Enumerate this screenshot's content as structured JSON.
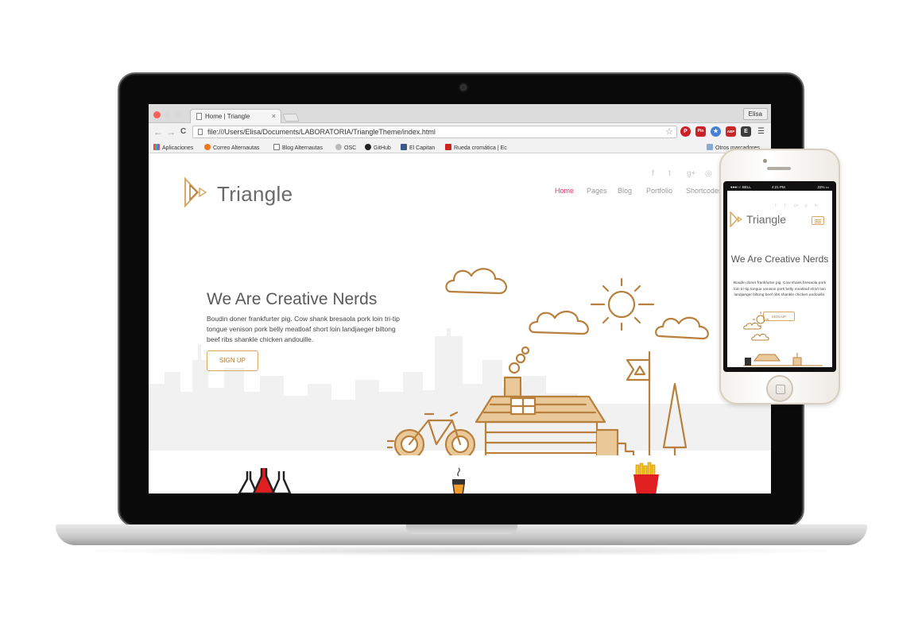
{
  "browser": {
    "tab_title": "Home | Triangle",
    "tab_close": "×",
    "user_name": "Elisa",
    "url": "file:///Users/Elisa/Documents/LABORATORIA/TriangleTheme/index.html",
    "back": "←",
    "forward": "→",
    "reload": "C",
    "menu": "☰",
    "bookmarks": [
      {
        "label": "Aplicaciones",
        "icon_color": "#e44"
      },
      {
        "label": "Correo Alternautas",
        "icon_color": "#f2771c"
      },
      {
        "label": "Blog Alternautas",
        "icon_color": "#ffffff"
      },
      {
        "label": "OSC",
        "icon_color": "#bbbbbb"
      },
      {
        "label": "GitHub",
        "icon_color": "#222222"
      },
      {
        "label": "El Capitan",
        "icon_color": "#3a5a88"
      },
      {
        "label": "Rueda cromática | Ec",
        "icon_color": "#cc2222"
      }
    ],
    "other_bookmarks": "Otros marcadores",
    "extensions": [
      {
        "name": "pinterest-icon",
        "text": "P",
        "color": "#cb2027"
      },
      {
        "name": "pin-icon",
        "text": "Pin",
        "color": "#cb2027"
      },
      {
        "name": "star-extension-icon",
        "text": "★",
        "color": "#4a7fd8"
      },
      {
        "name": "adblock-icon",
        "text": "ABP",
        "color": "#c62828"
      },
      {
        "name": "evernote-icon",
        "text": "E",
        "color": "#3d3d3d"
      }
    ]
  },
  "site": {
    "logo": "Triangle",
    "social": [
      "f",
      "t",
      "g+",
      "◎",
      "in"
    ],
    "nav": [
      {
        "label": "Home",
        "active": true
      },
      {
        "label": "Pages",
        "active": false
      },
      {
        "label": "Blog",
        "active": false
      },
      {
        "label": "Portfolio",
        "active": false
      },
      {
        "label": "Shortcodes",
        "active": false
      }
    ],
    "headline": "We Are Creative Nerds",
    "body": "Boudin doner frankfurter pig. Cow shank bresaola pork loin tri-tip tongue venison pork belly meatloaf short loin landjaeger biltong beef ribs shankle chicken andouille.",
    "cta": "SIGN UP"
  },
  "phone": {
    "carrier": "●●●○○ BELL",
    "time": "4:21 PM",
    "battery": "22% ▭",
    "logo": "Triangle",
    "headline": "We Are Creative Nerds",
    "body": "Boudin doner frankfurter pig. Cow shank bresaola pork loin tri-tip tongue venison pork belly meatloaf short loin landjaeger biltong beef ribs shankle chicken andouille.",
    "cta": "SIGN UP",
    "social": [
      "f",
      "t",
      "g+",
      "◎",
      "in"
    ]
  },
  "colors": {
    "accent": "#e8336b",
    "gold": "#c0893f"
  }
}
